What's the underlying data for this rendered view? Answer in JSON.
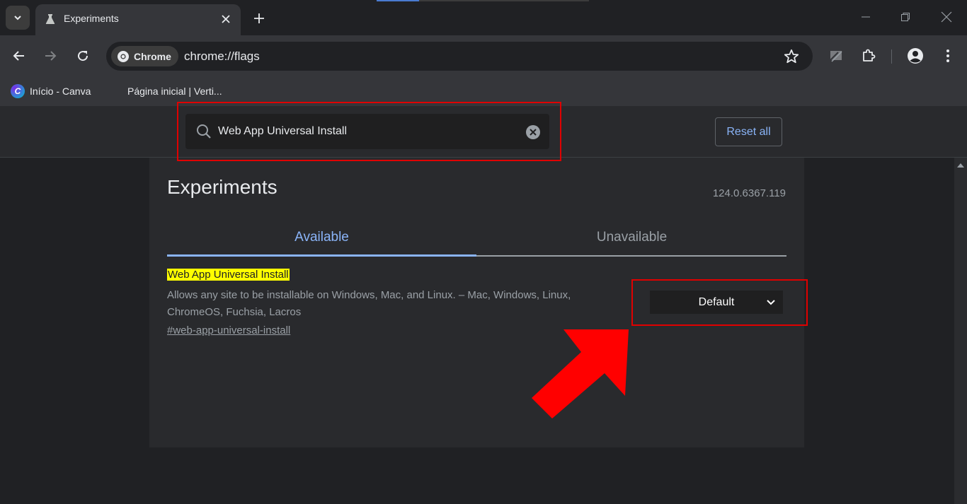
{
  "browser": {
    "tab": {
      "title": "Experiments"
    },
    "omnibox": {
      "chip_label": "Chrome",
      "url": "chrome://flags"
    },
    "bookmarks": [
      {
        "label": "Início - Canva"
      },
      {
        "label": "Página inicial | Verti..."
      }
    ]
  },
  "flags_page": {
    "search": {
      "value": "Web App Universal Install"
    },
    "reset_all_label": "Reset all",
    "title": "Experiments",
    "version": "124.0.6367.119",
    "tabs": [
      {
        "label": "Available"
      },
      {
        "label": "Unavailable"
      }
    ],
    "flag": {
      "name": "Web App Universal Install",
      "description": "Allows any site to be installable on Windows, Mac, and Linux. – Mac, Windows, Linux, ChromeOS, Fuchsia, Lacros",
      "link": "#web-app-universal-install",
      "selected_option": "Default"
    }
  },
  "colors": {
    "accent": "#8ab4f8",
    "highlight": "#ffff00",
    "annotation": "#e00000"
  }
}
